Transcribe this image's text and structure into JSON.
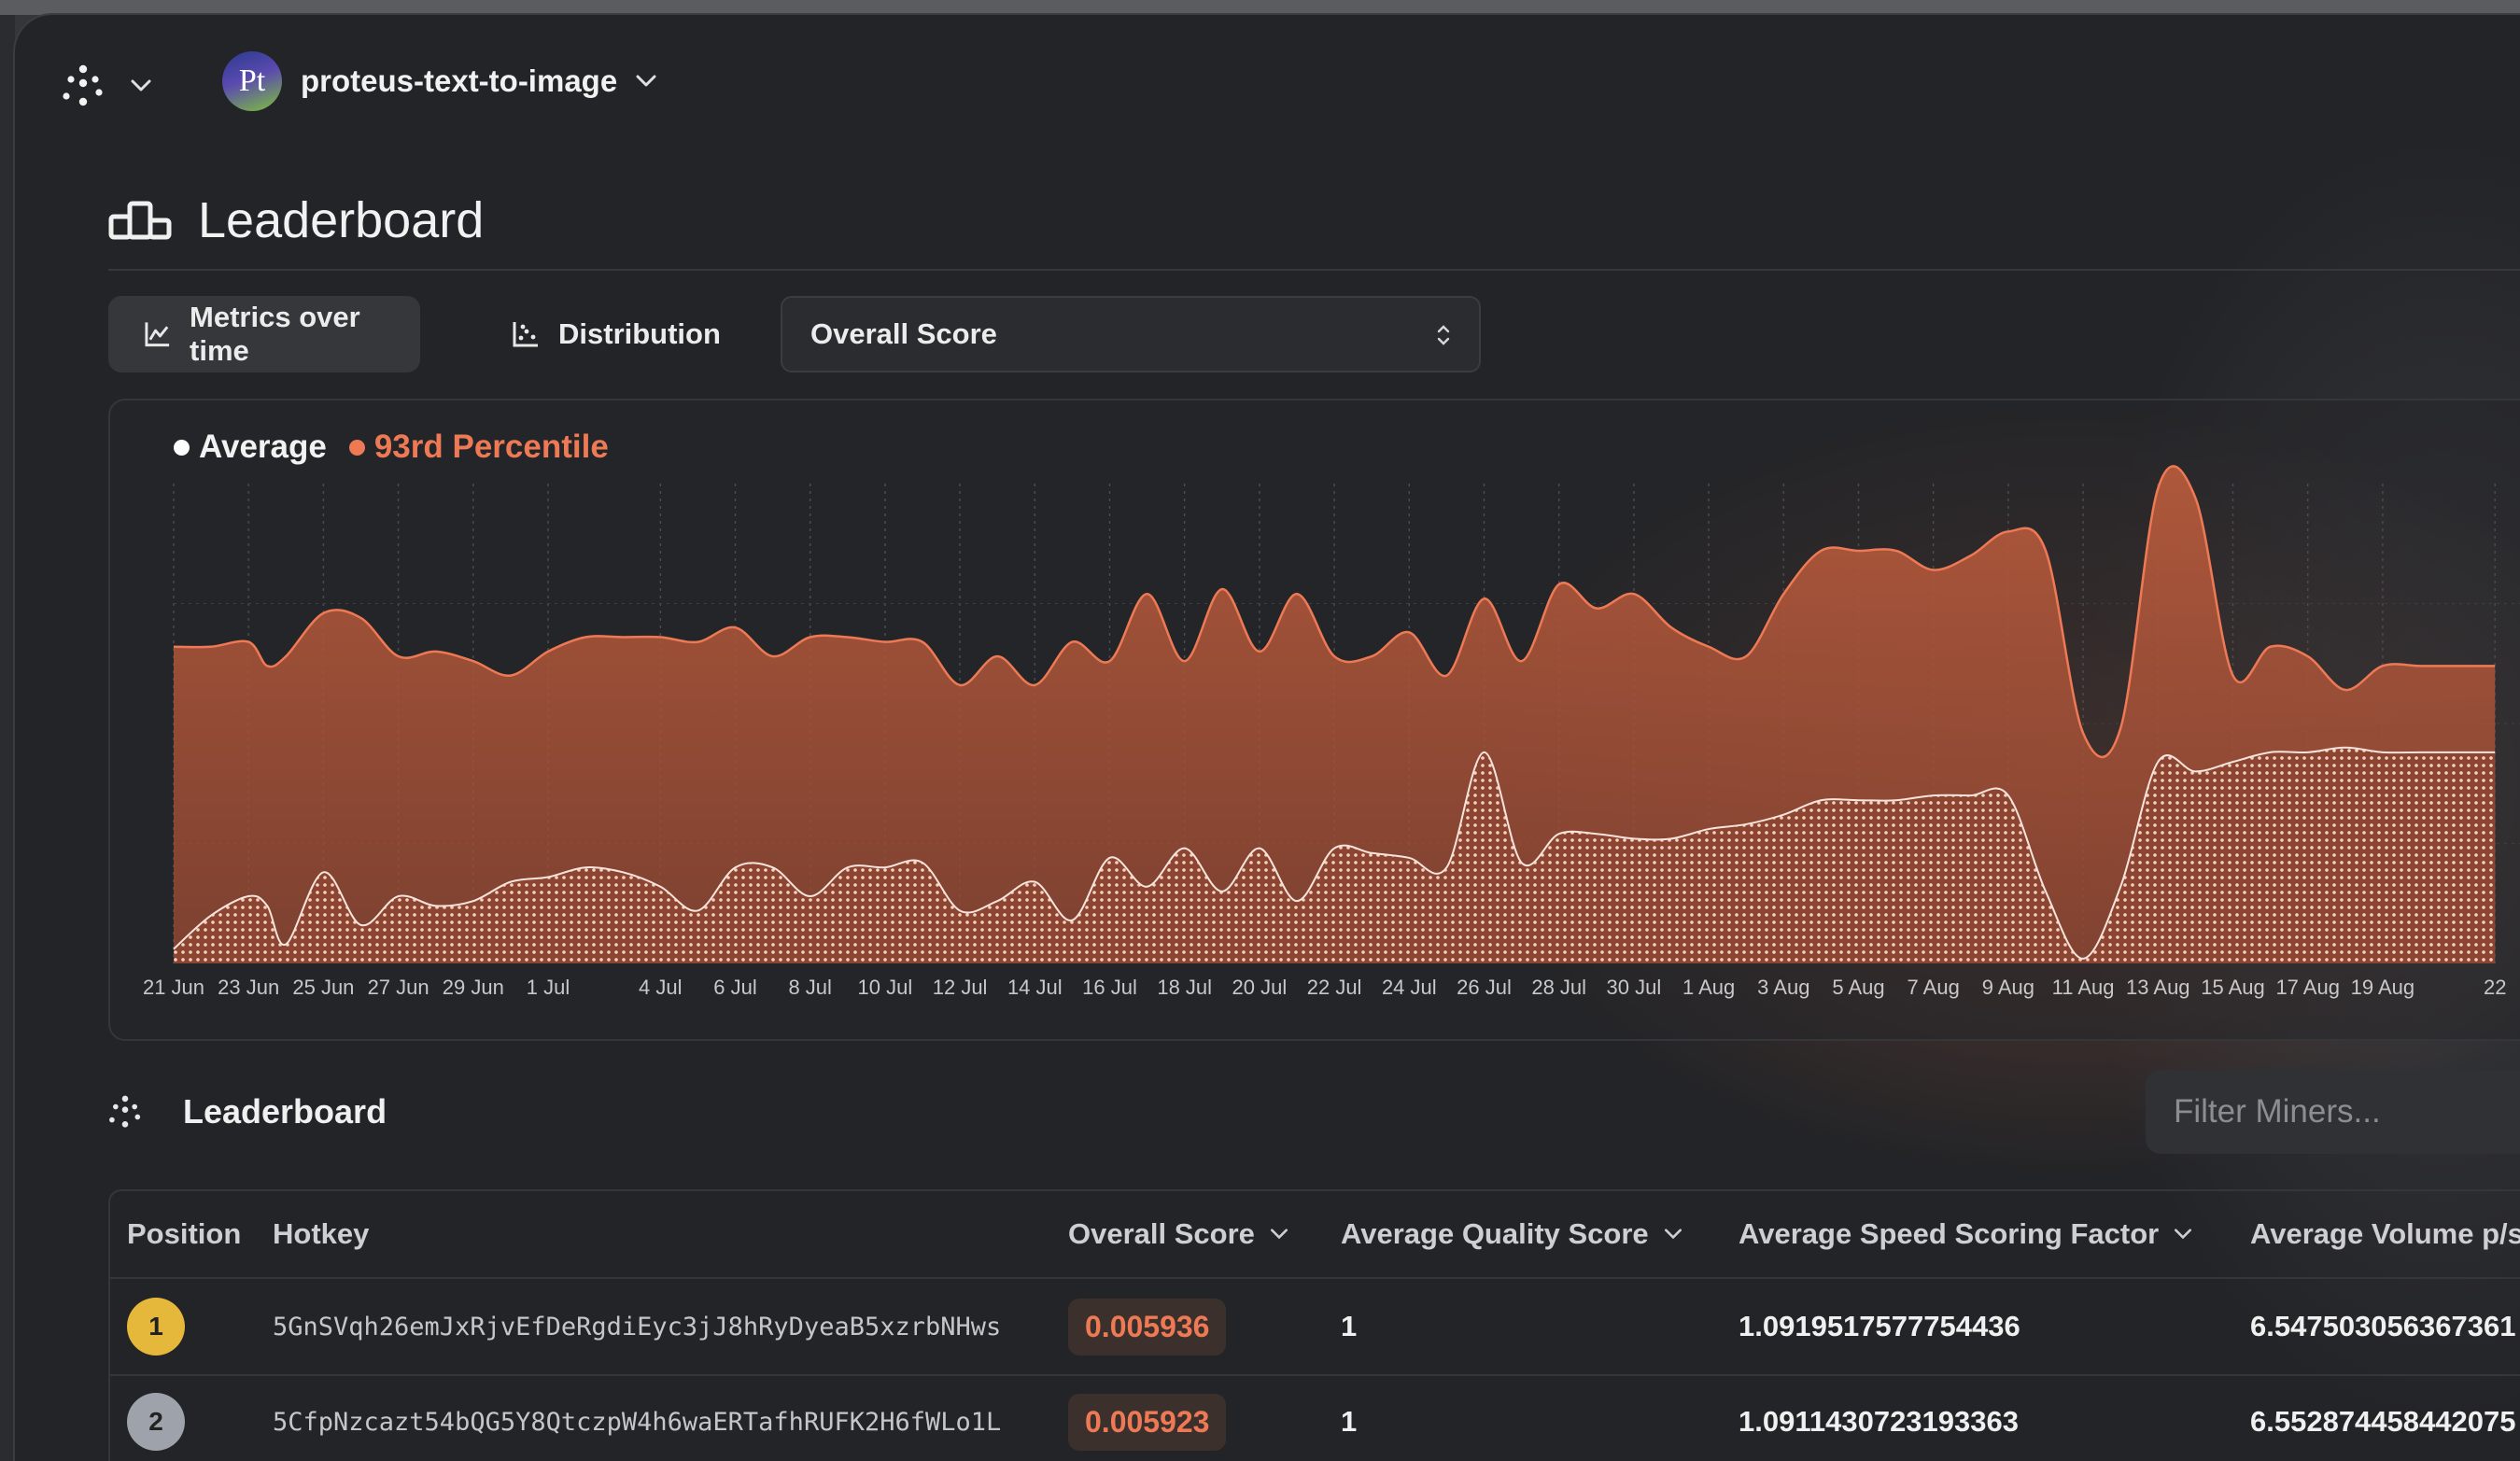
{
  "header": {
    "project_avatar": "Pt",
    "project_name": "proteus-text-to-image"
  },
  "page": {
    "title": "Leaderboard"
  },
  "tabs": [
    {
      "label": "Metrics over time",
      "icon": "line-chart-icon",
      "active": true
    },
    {
      "label": "Distribution",
      "icon": "scatter-chart-icon",
      "active": false
    }
  ],
  "metric_select": {
    "value": "Overall Score"
  },
  "legend": [
    {
      "label": "Average",
      "color": "#ffffff"
    },
    {
      "label": "93rd Percentile",
      "color": "#ee7a55"
    }
  ],
  "chart_data": {
    "type": "area",
    "title": "",
    "xlabel": "",
    "ylabel": "",
    "grid": true,
    "legend_position": "top-left",
    "tick_labels": [
      "21 Jun",
      "23 Jun",
      "25 Jun",
      "27 Jun",
      "29 Jun",
      "1 Jul",
      "4 Jul",
      "6 Jul",
      "8 Jul",
      "10 Jul",
      "12 Jul",
      "14 Jul",
      "16 Jul",
      "18 Jul",
      "20 Jul",
      "22 Jul",
      "24 Jul",
      "26 Jul",
      "28 Jul",
      "30 Jul",
      "1 Aug",
      "3 Aug",
      "5 Aug",
      "7 Aug",
      "9 Aug",
      "11 Aug",
      "13 Aug",
      "15 Aug",
      "17 Aug",
      "19 Aug",
      "22"
    ],
    "tick_days": [
      0,
      2,
      4,
      6,
      8,
      10,
      13,
      15,
      17,
      19,
      21,
      23,
      25,
      27,
      29,
      31,
      33,
      35,
      37,
      39,
      41,
      43,
      45,
      47,
      49,
      51,
      53,
      55,
      57,
      59,
      62
    ],
    "ylim": [
      0,
      100
    ],
    "x_days": [
      0,
      1,
      2,
      2.5,
      3,
      4,
      5,
      6,
      7,
      8,
      9,
      10,
      11,
      12,
      13,
      14,
      15,
      16,
      17,
      18,
      19,
      20,
      21,
      22,
      23,
      24,
      25,
      26,
      27,
      28,
      29,
      30,
      31,
      32,
      33,
      34,
      35,
      36,
      37,
      38,
      39,
      40,
      41,
      42,
      43,
      44,
      45,
      46,
      47,
      48,
      49,
      50,
      51,
      52,
      53,
      54,
      55,
      56,
      57,
      58,
      59,
      60,
      61,
      62
    ],
    "series": [
      {
        "name": "93rd Percentile",
        "color": "#ee7a55",
        "values": [
          66,
          66,
          67,
          62,
          64,
          73,
          72,
          64,
          65,
          63,
          60,
          65,
          68,
          68,
          68,
          67,
          70,
          64,
          68,
          68,
          67,
          67,
          58,
          64,
          58,
          67,
          63,
          77,
          63,
          78,
          65,
          77,
          64,
          64,
          69,
          60,
          76,
          63,
          79,
          74,
          77,
          70,
          66,
          64,
          77,
          86,
          86,
          86,
          82,
          85,
          90,
          86,
          48,
          49,
          99,
          97,
          60,
          66,
          64,
          57,
          62,
          62,
          62,
          62
        ]
      },
      {
        "name": "Average",
        "color": "#ffffff",
        "values": [
          3,
          10,
          14,
          12,
          4,
          19,
          8,
          14,
          12,
          13,
          17,
          18,
          20,
          19,
          16,
          11,
          20,
          20,
          14,
          20,
          20,
          21,
          11,
          13,
          17,
          9,
          22,
          16,
          24,
          15,
          24,
          13,
          24,
          23,
          22,
          20,
          44,
          21,
          27,
          27,
          26,
          26,
          28,
          29,
          31,
          34,
          34,
          34,
          35,
          35,
          35,
          15,
          1,
          16,
          42,
          40,
          42,
          44,
          44,
          45,
          44,
          44,
          44,
          44
        ]
      }
    ]
  },
  "leaderboard": {
    "title": "Leaderboard",
    "filter_placeholder": "Filter Miners...",
    "columns": [
      {
        "label": "Position",
        "sortable": false
      },
      {
        "label": "Hotkey",
        "sortable": false
      },
      {
        "label": "Overall Score",
        "sortable": true
      },
      {
        "label": "Average Quality Score",
        "sortable": true
      },
      {
        "label": "Average Speed Scoring Factor",
        "sortable": true
      },
      {
        "label": "Average Volume p/s",
        "sortable": true
      }
    ],
    "rows": [
      {
        "position": "1",
        "badge_color": "#e5b73b",
        "hotkey": "5GnSVqh26emJxRjvEfDeRgdiEyc3jJ8hRyDyeaB5xzrbNHws",
        "overall_score": "0.005936",
        "quality": "1",
        "speed": "1.0919517577754436",
        "volume": "6.547503056367361"
      },
      {
        "position": "2",
        "badge_color": "#9ea3ab",
        "hotkey": "5CfpNzcazt54bQG5Y8QtczpW4h6waERTafhRUFK2H6fWLo1L",
        "overall_score": "0.005923",
        "quality": "1",
        "speed": "1.0911430723193363",
        "volume": "6.552874458442075"
      }
    ]
  }
}
